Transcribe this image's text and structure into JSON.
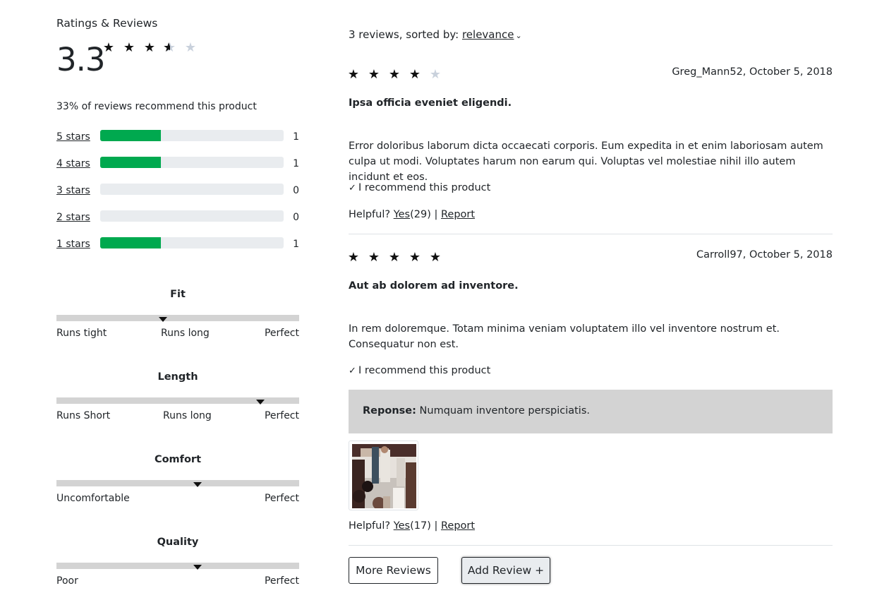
{
  "summary": {
    "heading": "Ratings & Reviews",
    "average": "3.3",
    "average_value": 3.3,
    "recommend_text": "33% of reviews recommend this product"
  },
  "breakdown": [
    {
      "label": "5 stars",
      "fraction": 0.33,
      "count": "1"
    },
    {
      "label": "4 stars",
      "fraction": 0.33,
      "count": "1"
    },
    {
      "label": "3 stars",
      "fraction": 0,
      "count": "0"
    },
    {
      "label": "2 stars",
      "fraction": 0,
      "count": "0"
    },
    {
      "label": "1 stars",
      "fraction": 0.33,
      "count": "1"
    }
  ],
  "characteristics": [
    {
      "name": "Fit",
      "value": 0.44,
      "labels": [
        "Runs tight",
        "Runs long",
        "Perfect"
      ]
    },
    {
      "name": "Length",
      "value": 0.84,
      "labels": [
        "Runs Short",
        "Runs long",
        "Perfect"
      ]
    },
    {
      "name": "Comfort",
      "value": 0.58,
      "labels": [
        "Uncomfortable",
        "Perfect"
      ]
    },
    {
      "name": "Quality",
      "value": 0.58,
      "labels": [
        "Poor",
        "Perfect"
      ]
    }
  ],
  "sort": {
    "prefix": "3 reviews, sorted by: ",
    "value": "relevance",
    "chevron_icon": "chevron-down-icon"
  },
  "reviews": [
    {
      "rating": 4,
      "meta": "Greg_Mann52, October 5, 2018",
      "title": "Ipsa officia eveniet eligendi.",
      "body": "Error doloribus laborum dicta occaecati corporis. Eum expedita in et enim laboriosam autem culpa ut modi. Voluptates harum non earum qui. Voluptas vel molestiae nihil illo autem incidunt et eos.",
      "recommend": "I recommend this product",
      "helpful_prefix": "Helpful? ",
      "yes_label": "Yes",
      "yes_count": "(29)",
      "separator": " | ",
      "report_label": "Report"
    },
    {
      "rating": 5,
      "meta": "Carroll97, October 5, 2018",
      "title": "Aut ab dolorem ad inventore.",
      "body": "In rem doloremque. Totam minima veniam voluptatem illo vel inventore nostrum et. Consequatur non est.",
      "recommend": "I recommend this product",
      "response_label": "Reponse:",
      "response_text": " Numquam inventore perspiciatis.",
      "helpful_prefix": "Helpful? ",
      "yes_label": "Yes",
      "yes_count": "(17)",
      "separator": " | ",
      "report_label": "Report"
    }
  ],
  "buttons": {
    "more": "More Reviews",
    "add": "Add Review +"
  },
  "colors": {
    "bar_fill": "#00a94f",
    "bar_track": "#e9ecef",
    "response_bg": "#d3d3d3"
  }
}
